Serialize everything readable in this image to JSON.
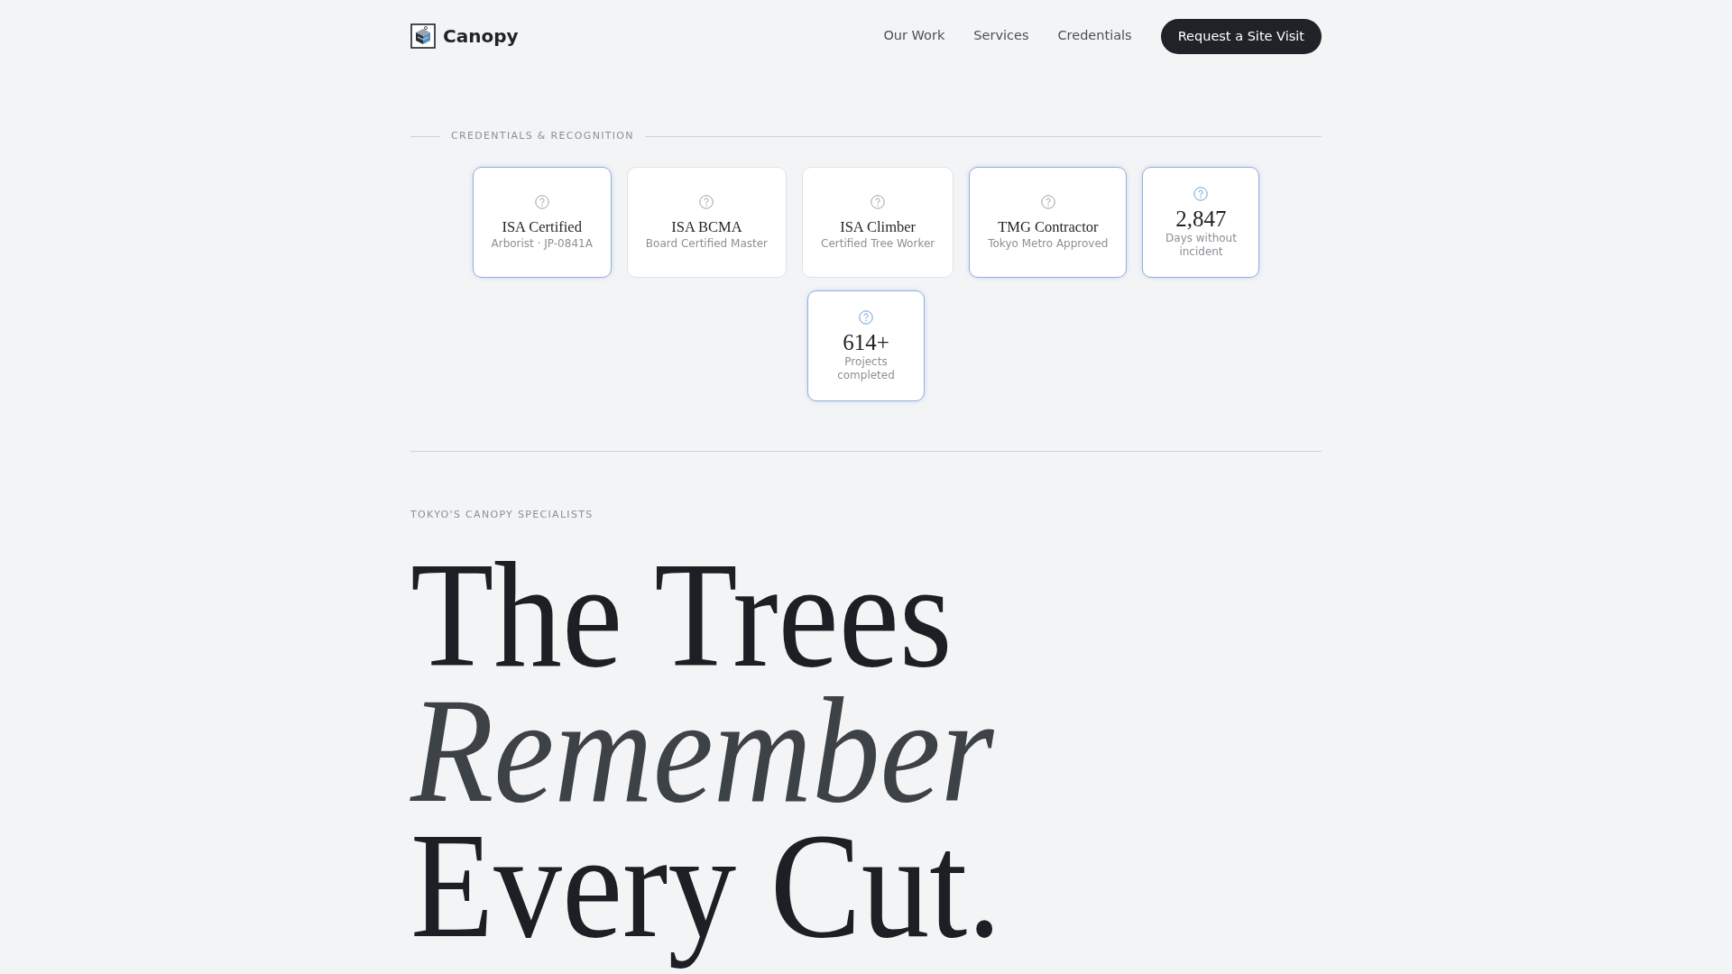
{
  "header": {
    "brand": "Canopy",
    "nav": [
      {
        "label": "Our Work"
      },
      {
        "label": "Services"
      },
      {
        "label": "Credentials"
      }
    ],
    "cta": "Request a Site Visit"
  },
  "credentials": {
    "label": "CREDENTIALS & RECOGNITION",
    "cards": [
      {
        "kind": "credential",
        "title": "ISA Certified",
        "subtitle": "Arborist · JP-0841A",
        "highlighted": true
      },
      {
        "kind": "credential",
        "title": "ISA BCMA",
        "subtitle": "Board Certified Master",
        "highlighted": false
      },
      {
        "kind": "credential",
        "title": "ISA Climber",
        "subtitle": "Certified Tree Worker",
        "highlighted": false
      },
      {
        "kind": "credential",
        "title": "TMG Contractor",
        "subtitle": "Tokyo Metro Approved",
        "highlighted": true
      },
      {
        "kind": "stat",
        "value": "2,847",
        "label": "Days without incident",
        "highlighted": true
      },
      {
        "kind": "stat",
        "value": "614+",
        "label": "Projects completed",
        "highlighted": true
      }
    ]
  },
  "hero": {
    "eyebrow": "TOKYO'S CANOPY SPECIALISTS",
    "headline": "The Trees *Remember* Every Cut."
  }
}
